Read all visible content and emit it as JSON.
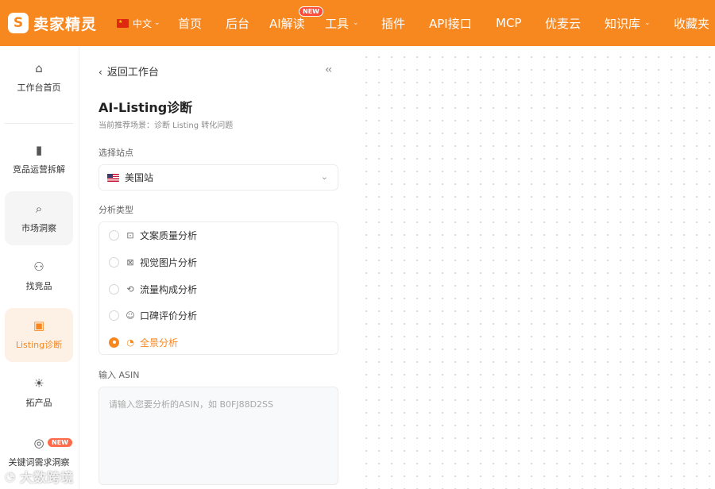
{
  "brand": {
    "name": "卖家精灵",
    "mark": "S"
  },
  "topnav": {
    "language": "中文",
    "items": [
      {
        "label": "首页"
      },
      {
        "label": "后台"
      },
      {
        "label": "AI解读",
        "badge": "NEW"
      },
      {
        "label": "工具",
        "has_dropdown": true
      },
      {
        "label": "插件"
      },
      {
        "label": "API接口"
      },
      {
        "label": "MCP"
      },
      {
        "label": "优麦云"
      },
      {
        "label": "知识库",
        "has_dropdown": true
      },
      {
        "label": "收藏夹"
      }
    ]
  },
  "sidebar": {
    "items": [
      {
        "label": "工作台首页",
        "icon": "home-icon"
      },
      {
        "label": "竞品运营拆解",
        "icon": "bar-chart-icon"
      },
      {
        "label": "市场洞察",
        "icon": "search-icon"
      },
      {
        "label": "找竞品",
        "icon": "users-icon"
      },
      {
        "label": "Listing诊断",
        "icon": "document-check-icon",
        "active": true
      },
      {
        "label": "拓产品",
        "icon": "bulb-icon"
      },
      {
        "label": "关键词需求洞察",
        "icon": "target-icon",
        "badge": "NEW"
      }
    ]
  },
  "panel": {
    "back_label": "返回工作台",
    "title": "AI-Listing诊断",
    "subtitle": "当前推荐场景：诊断 Listing 转化问题",
    "site_label": "选择站点",
    "site_value": "美国站",
    "type_label": "分析类型",
    "types": [
      {
        "label": "文案质量分析",
        "checked": false
      },
      {
        "label": "视觉图片分析",
        "checked": false
      },
      {
        "label": "流量构成分析",
        "checked": false
      },
      {
        "label": "口碑评价分析",
        "checked": false
      },
      {
        "label": "全景分析",
        "checked": true
      }
    ],
    "asin_label": "输入 ASIN",
    "asin_placeholder": "请输入您要分析的ASIN，如 B0FJ88D2SS"
  },
  "watermark": "大数跨境",
  "colors": {
    "accent": "#f7871f",
    "active_bg": "#fdf1e6",
    "badge": "#ff4d3a"
  }
}
